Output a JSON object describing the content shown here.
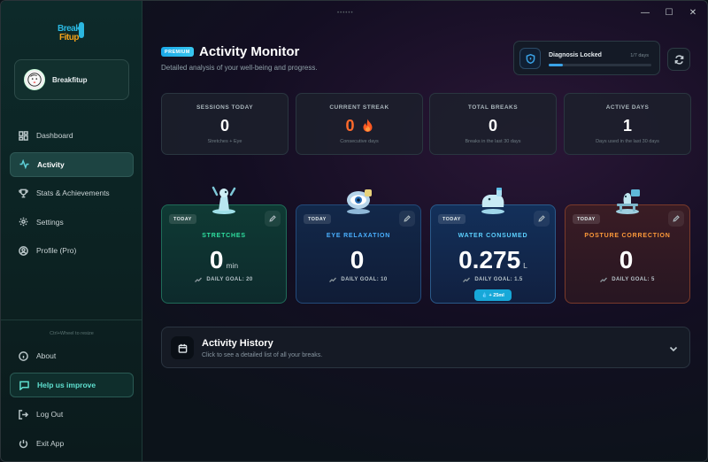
{
  "window": {
    "drag_handle": "••••••",
    "minimize": "—",
    "maximize": "☐",
    "close": "✕"
  },
  "logo": {
    "line1": "Break",
    "line2": "Fitup"
  },
  "user": {
    "name": "Breakfitup"
  },
  "nav": {
    "items": [
      {
        "label": "Dashboard",
        "icon": "dashboard-icon"
      },
      {
        "label": "Activity",
        "icon": "activity-icon",
        "active": true
      },
      {
        "label": "Stats & Achievements",
        "icon": "trophy-icon"
      },
      {
        "label": "Settings",
        "icon": "gear-icon"
      },
      {
        "label": "Profile (Pro)",
        "icon": "user-icon"
      }
    ],
    "resize_hint": "Ctrl+Wheel to resize",
    "bottom_items": [
      {
        "label": "About",
        "icon": "info-icon"
      },
      {
        "label": "Help us improve",
        "icon": "message-icon"
      },
      {
        "label": "Log Out",
        "icon": "logout-icon"
      },
      {
        "label": "Exit App",
        "icon": "power-icon"
      }
    ]
  },
  "header": {
    "badge": "PREMIUM",
    "title": "Activity Monitor",
    "subtitle": "Detailed analysis of your well-being and progress."
  },
  "diagnosis": {
    "title": "Diagnosis Locked",
    "count": "1/7 days",
    "progress": 0.14,
    "accent": "#3aa3e8"
  },
  "stats": [
    {
      "label": "SESSIONS TODAY",
      "value": "0",
      "sub": "Stretches + Eye"
    },
    {
      "label": "CURRENT STREAK",
      "value": "0",
      "sub": "Consecutive days",
      "color": "#ff6a2b"
    },
    {
      "label": "TOTAL BREAKS",
      "value": "0",
      "sub": "Breaks in the last 30 days"
    },
    {
      "label": "ACTIVE DAYS",
      "value": "1",
      "sub": "Days used in the last 30 days"
    }
  ],
  "activities": [
    {
      "today": "TODAY",
      "title": "STRETCHES",
      "value": "0",
      "unit": "min",
      "goal": "DAILY GOAL: 20",
      "color": "#2ee0a0"
    },
    {
      "today": "TODAY",
      "title": "EYE RELAXATION",
      "value": "0",
      "unit": "",
      "goal": "DAILY GOAL: 10",
      "color": "#4ab0ff"
    },
    {
      "today": "TODAY",
      "title": "WATER CONSUMED",
      "value": "0.275",
      "unit": "L",
      "goal": "DAILY GOAL: 1.5",
      "quick_add": "💧 + 25ml",
      "color": "#5cd0ff"
    },
    {
      "today": "TODAY",
      "title": "POSTURE CORRECTION",
      "value": "0",
      "unit": "",
      "goal": "DAILY GOAL: 5",
      "color": "#ff9a3a"
    }
  ],
  "history": {
    "title": "Activity History",
    "subtitle": "Click to see a detailed list of all your breaks."
  }
}
